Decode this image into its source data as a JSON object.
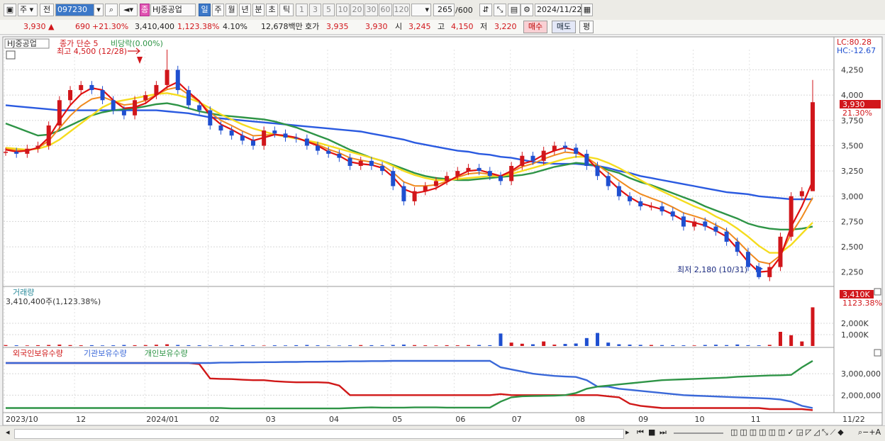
{
  "toolbar": {
    "period_label": "주",
    "prev_label": "전",
    "code": "097230",
    "stock_badge": "종",
    "stock_name": "HJ중공업",
    "periods": [
      "일",
      "주",
      "월",
      "년",
      "분",
      "초",
      "틱"
    ],
    "minutes": [
      "1",
      "3",
      "5",
      "10",
      "20",
      "30",
      "60",
      "120"
    ],
    "count": "265",
    "count_total": "/600",
    "date": "2024/11/22"
  },
  "quote": {
    "price": "3,930",
    "change": "690",
    "change_pct": "+21.30%",
    "volume": "3,410,400",
    "volume_pct": "1,123.38%",
    "turnover": "4.10%",
    "amount": "12,678백만",
    "bid_label": "호가",
    "bid": "3,935",
    "ask": "3,930",
    "open_label": "시",
    "open": "3,245",
    "high_label": "고",
    "high": "4,150",
    "low_label": "저",
    "low": "3,220",
    "buy_label": "매수",
    "sell_label": "매도",
    "avg_label": "평"
  },
  "chart_data": {
    "type": "candlestick",
    "price_panel": {
      "legend": [
        "HJ중공업",
        "종가 단순 5",
        "비당락(0.00%)"
      ],
      "lc": "LC:80.28",
      "hc": "HC:-12.67",
      "high_annotation": "최고 4,500 (12/28)",
      "low_annotation": "최저 2,180 (10/31)",
      "y_ticks": [
        "4,250",
        "4,000",
        "3,750",
        "3,500",
        "3,250",
        "3,000",
        "2,750",
        "2,500",
        "2,250"
      ],
      "ylim": [
        2150,
        4450
      ],
      "last_price_label": "3,930",
      "last_pct_label": "21.30%",
      "close": [
        3440,
        3420,
        3470,
        3500,
        3700,
        3950,
        4050,
        4100,
        4050,
        3950,
        3850,
        3800,
        3950,
        4000,
        4100,
        4250,
        4050,
        3900,
        3850,
        3700,
        3650,
        3600,
        3550,
        3500,
        3650,
        3620,
        3580,
        3570,
        3500,
        3450,
        3420,
        3380,
        3300,
        3350,
        3300,
        3250,
        3100,
        2950,
        3050,
        3100,
        3150,
        3200,
        3250,
        3280,
        3250,
        3200,
        3150,
        3300,
        3400,
        3350,
        3450,
        3500,
        3480,
        3420,
        3300,
        3200,
        3100,
        3000,
        2950,
        2900,
        2900,
        2850,
        2800,
        2700,
        2750,
        2700,
        2650,
        2550,
        2450,
        2300,
        2200,
        2300,
        2600,
        3000,
        3050,
        3930
      ],
      "sma5": [
        3460,
        3440,
        3450,
        3480,
        3580,
        3750,
        3900,
        4010,
        4070,
        4050,
        3950,
        3870,
        3880,
        3920,
        4000,
        4080,
        4130,
        4030,
        3940,
        3800,
        3710,
        3660,
        3600,
        3550,
        3580,
        3610,
        3600,
        3580,
        3540,
        3500,
        3440,
        3400,
        3340,
        3320,
        3310,
        3280,
        3190,
        3070,
        3030,
        3050,
        3080,
        3140,
        3200,
        3250,
        3260,
        3230,
        3200,
        3250,
        3320,
        3350,
        3410,
        3450,
        3480,
        3450,
        3380,
        3270,
        3170,
        3070,
        2990,
        2930,
        2900,
        2870,
        2820,
        2760,
        2740,
        2710,
        2660,
        2600,
        2480,
        2350,
        2250,
        2260,
        2400,
        2700,
        2900,
        3150
      ],
      "sma20": [
        3480,
        3470,
        3460,
        3470,
        3500,
        3560,
        3640,
        3720,
        3800,
        3880,
        3930,
        3950,
        3970,
        3990,
        4010,
        4020,
        4000,
        3970,
        3930,
        3870,
        3810,
        3760,
        3710,
        3670,
        3640,
        3610,
        3590,
        3570,
        3550,
        3530,
        3500,
        3470,
        3440,
        3410,
        3380,
        3350,
        3300,
        3250,
        3210,
        3180,
        3160,
        3160,
        3170,
        3180,
        3190,
        3200,
        3200,
        3220,
        3250,
        3280,
        3310,
        3340,
        3370,
        3390,
        3390,
        3370,
        3330,
        3280,
        3220,
        3160,
        3100,
        3050,
        3000,
        2950,
        2900,
        2860,
        2800,
        2750,
        2680,
        2600,
        2510,
        2440,
        2440,
        2520,
        2630,
        2740
      ],
      "sma60": [
        3720,
        3680,
        3640,
        3600,
        3610,
        3650,
        3700,
        3750,
        3800,
        3830,
        3850,
        3860,
        3870,
        3890,
        3910,
        3920,
        3900,
        3870,
        3840,
        3820,
        3800,
        3790,
        3780,
        3770,
        3760,
        3740,
        3710,
        3680,
        3640,
        3600,
        3560,
        3510,
        3460,
        3420,
        3380,
        3350,
        3310,
        3270,
        3230,
        3200,
        3180,
        3170,
        3160,
        3160,
        3170,
        3180,
        3190,
        3200,
        3210,
        3230,
        3260,
        3290,
        3310,
        3330,
        3320,
        3300,
        3260,
        3230,
        3180,
        3140,
        3110,
        3070,
        3030,
        2990,
        2950,
        2900,
        2860,
        2820,
        2780,
        2730,
        2700,
        2680,
        2670,
        2670,
        2680,
        2700
      ],
      "sma120": [
        3900,
        3890,
        3880,
        3870,
        3860,
        3850,
        3850,
        3850,
        3850,
        3850,
        3850,
        3850,
        3850,
        3850,
        3850,
        3840,
        3830,
        3820,
        3800,
        3780,
        3770,
        3760,
        3750,
        3740,
        3730,
        3720,
        3710,
        3700,
        3690,
        3680,
        3670,
        3660,
        3650,
        3640,
        3620,
        3600,
        3580,
        3560,
        3530,
        3510,
        3490,
        3470,
        3450,
        3440,
        3420,
        3410,
        3390,
        3380,
        3360,
        3340,
        3330,
        3320,
        3320,
        3320,
        3310,
        3300,
        3280,
        3250,
        3230,
        3200,
        3180,
        3160,
        3140,
        3120,
        3100,
        3080,
        3060,
        3040,
        3030,
        3020,
        3000,
        2990,
        2980,
        2970,
        2970,
        2970
      ]
    },
    "volume_panel": {
      "title": "거래량",
      "value_label": "3,410,400주(1,123.38%)",
      "y_ticks": [
        "2,000K",
        "1,000K"
      ],
      "last_label": "3,410K",
      "last_pct": "1123.38%",
      "ylim": [
        0,
        3500
      ],
      "values": [
        80,
        60,
        50,
        70,
        90,
        120,
        80,
        60,
        70,
        50,
        60,
        90,
        70,
        80,
        110,
        150,
        90,
        70,
        60,
        50,
        40,
        60,
        70,
        50,
        40,
        60,
        50,
        70,
        90,
        60,
        50,
        40,
        60,
        80,
        70,
        60,
        90,
        120,
        80,
        60,
        50,
        70,
        60,
        80,
        90,
        70,
        1100,
        300,
        200,
        150,
        400,
        120,
        180,
        220,
        700,
        1150,
        300,
        150,
        120,
        100,
        90,
        80,
        70,
        60,
        50,
        90,
        110,
        80,
        130,
        70,
        60,
        100,
        1250,
        950,
        400,
        3410
      ]
    },
    "holding_panel": {
      "legend": [
        "외국인보유수량",
        "기관보유수량",
        "개인보유수량"
      ],
      "y_ticks": [
        "3,000,000",
        "2,000,000"
      ],
      "ylim": [
        1250000,
        3700000
      ],
      "foreign": [
        3500000,
        3500000,
        3500000,
        3500000,
        3500000,
        3500000,
        3500000,
        3500000,
        3500000,
        3500000,
        3500000,
        3500000,
        3500000,
        3500000,
        3500000,
        3500000,
        3500000,
        3500000,
        3450000,
        2780000,
        2760000,
        2750000,
        2720000,
        2700000,
        2700000,
        2650000,
        2620000,
        2600000,
        2600000,
        2600000,
        2580000,
        2450000,
        2000000,
        2000000,
        2000000,
        2000000,
        2000000,
        2000000,
        2000000,
        2000000,
        2000000,
        2000000,
        2000000,
        2000000,
        2000000,
        2000000,
        2050000,
        2000000,
        2000000,
        2000000,
        2000000,
        2000000,
        2000000,
        2000000,
        2000000,
        2000000,
        1950000,
        1900000,
        1600000,
        1500000,
        1450000,
        1400000,
        1400000,
        1400000,
        1400000,
        1400000,
        1400000,
        1400000,
        1400000,
        1400000,
        1400000,
        1350000,
        1350000,
        1350000,
        1350000,
        1300000
      ],
      "institution": [
        3500000,
        3500000,
        3500000,
        3500000,
        3500000,
        3500000,
        3500000,
        3500000,
        3500000,
        3500000,
        3500000,
        3500000,
        3500000,
        3500000,
        3500000,
        3500000,
        3500000,
        3500000,
        3500000,
        3500000,
        3520000,
        3520000,
        3530000,
        3530000,
        3540000,
        3540000,
        3550000,
        3550000,
        3560000,
        3560000,
        3570000,
        3570000,
        3580000,
        3580000,
        3590000,
        3590000,
        3600000,
        3600000,
        3600000,
        3600000,
        3600000,
        3600000,
        3600000,
        3600000,
        3600000,
        3600000,
        3300000,
        3200000,
        3100000,
        3000000,
        2950000,
        2900000,
        2870000,
        2850000,
        2700000,
        2400000,
        2400000,
        2300000,
        2250000,
        2200000,
        2150000,
        2100000,
        2050000,
        2000000,
        1980000,
        1960000,
        1940000,
        1920000,
        1900000,
        1880000,
        1860000,
        1840000,
        1800000,
        1700000,
        1500000,
        1400000
      ],
      "individual": [
        1400000,
        1400000,
        1400000,
        1400000,
        1400000,
        1400000,
        1400000,
        1400000,
        1400000,
        1400000,
        1400000,
        1400000,
        1400000,
        1400000,
        1400000,
        1400000,
        1400000,
        1400000,
        1400000,
        1400000,
        1400000,
        1380000,
        1380000,
        1380000,
        1380000,
        1380000,
        1380000,
        1380000,
        1380000,
        1380000,
        1380000,
        1380000,
        1400000,
        1420000,
        1430000,
        1420000,
        1420000,
        1420000,
        1430000,
        1430000,
        1430000,
        1420000,
        1420000,
        1420000,
        1420000,
        1420000,
        1700000,
        1900000,
        1950000,
        1960000,
        1970000,
        1980000,
        2000000,
        2100000,
        2300000,
        2400000,
        2450000,
        2500000,
        2550000,
        2600000,
        2650000,
        2700000,
        2720000,
        2740000,
        2760000,
        2780000,
        2800000,
        2820000,
        2860000,
        2880000,
        2900000,
        2920000,
        2930000,
        2950000,
        3300000,
        3600000
      ]
    },
    "x_labels": [
      "2023/10",
      "12",
      "2024/01",
      "02",
      "03",
      "04",
      "05",
      "06",
      "07",
      "08",
      "09",
      "10",
      "11",
      "11/22"
    ],
    "x_label_index": [
      0,
      10,
      20,
      29,
      37,
      46,
      55,
      64,
      72,
      81,
      90,
      98,
      106,
      115
    ]
  },
  "colors": {
    "up": "#d1161b",
    "down": "#1f4fd0",
    "sma5": "#e01010",
    "sma20": "#f5dc1e",
    "sma60": "#2e9446",
    "sma120": "#2a5ae0",
    "foreign": "#d01818",
    "institution": "#3a68d8",
    "individual": "#2e9446",
    "orange": "#f08a1e"
  }
}
